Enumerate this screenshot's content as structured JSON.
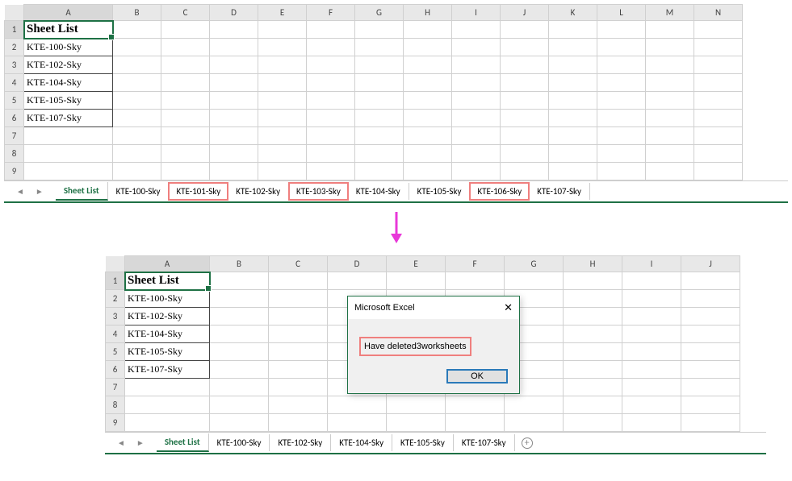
{
  "columns_top": [
    "A",
    "B",
    "C",
    "D",
    "E",
    "F",
    "G",
    "H",
    "I",
    "J",
    "K",
    "L",
    "M",
    "N"
  ],
  "columns_bot": [
    "A",
    "B",
    "C",
    "D",
    "E",
    "F",
    "G",
    "H",
    "I",
    "J"
  ],
  "rows_top": [
    "1",
    "2",
    "3",
    "4",
    "5",
    "6",
    "7",
    "8",
    "9"
  ],
  "rows_bot": [
    "1",
    "2",
    "3",
    "4",
    "5",
    "6",
    "7",
    "8",
    "9"
  ],
  "listHeader": "Sheet List",
  "listItems": [
    "KTE-100-Sky",
    "KTE-102-Sky",
    "KTE-104-Sky",
    "KTE-105-Sky",
    "KTE-107-Sky"
  ],
  "tabs_top": {
    "active": "Sheet List",
    "items": [
      "KTE-100-Sky",
      "KTE-101-Sky",
      "KTE-102-Sky",
      "KTE-103-Sky",
      "KTE-104-Sky",
      "KTE-105-Sky",
      "KTE-106-Sky",
      "KTE-107-Sky"
    ],
    "highlighted": [
      "KTE-101-Sky",
      "KTE-103-Sky",
      "KTE-106-Sky"
    ]
  },
  "tabs_bot": {
    "active": "Sheet List",
    "items": [
      "KTE-100-Sky",
      "KTE-102-Sky",
      "KTE-104-Sky",
      "KTE-105-Sky",
      "KTE-107-Sky"
    ]
  },
  "dialog": {
    "title": "Microsoft Excel",
    "message": "Have deleted3worksheets",
    "ok": "OK"
  }
}
